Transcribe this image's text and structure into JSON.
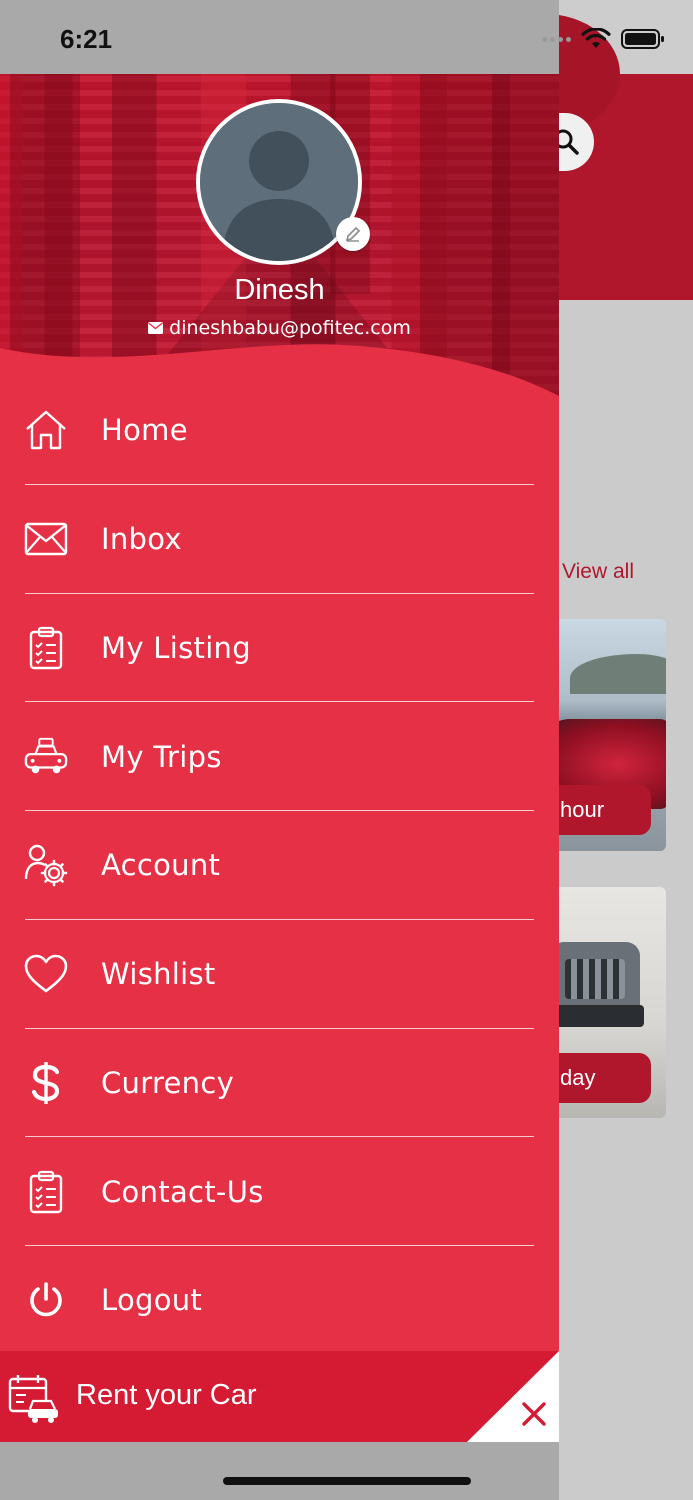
{
  "status_bar": {
    "time": "6:21"
  },
  "background": {
    "view_all": "View all",
    "card_1_price_unit": "hour",
    "card_2_price_unit": "day"
  },
  "drawer": {
    "user": {
      "name": "Dinesh",
      "email": "dineshbabu@pofitec.com"
    },
    "menu": [
      {
        "label": "Home",
        "icon": "home-icon"
      },
      {
        "label": "Inbox",
        "icon": "mail-icon"
      },
      {
        "label": "My Listing",
        "icon": "clipboard-list-icon"
      },
      {
        "label": "My Trips",
        "icon": "taxi-icon"
      },
      {
        "label": "Account",
        "icon": "user-settings-icon"
      },
      {
        "label": "Wishlist",
        "icon": "heart-icon"
      },
      {
        "label": "Currency",
        "icon": "dollar-icon"
      },
      {
        "label": "Contact-Us",
        "icon": "clipboard-check-icon"
      },
      {
        "label": "Logout",
        "icon": "power-icon"
      }
    ],
    "rent_your_car": {
      "label": "Rent your Car",
      "icon": "calendar-car-icon"
    },
    "close_icon": "close-icon"
  },
  "colors": {
    "drawer": "#e53045",
    "rent_bar": "#d41b33",
    "header": "#b0172c",
    "close_x": "#d41b33"
  }
}
